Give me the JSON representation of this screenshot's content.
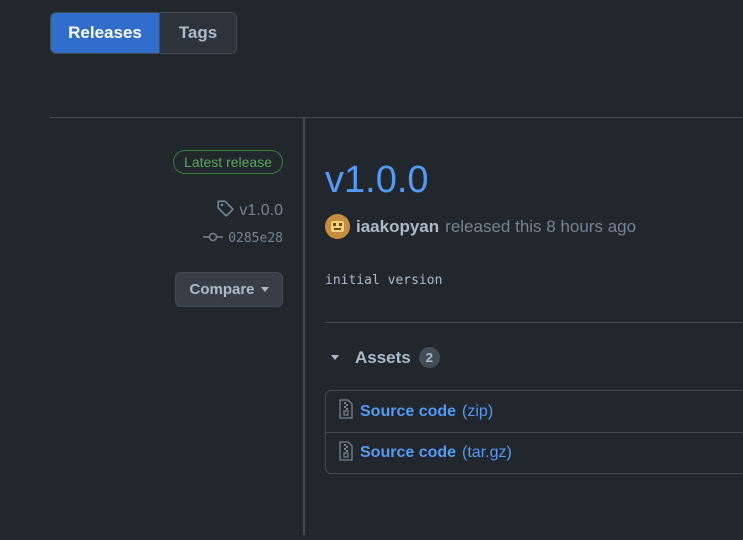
{
  "tabs": {
    "releases_label": "Releases",
    "tags_label": "Tags"
  },
  "sidebar": {
    "latest_badge": "Latest release",
    "tag": "v1.0.0",
    "commit": "0285e28",
    "compare_label": "Compare"
  },
  "release": {
    "title": "v1.0.0",
    "author": "iaakopyan",
    "released_text": "released this 8 hours ago",
    "body": "initial version"
  },
  "assets": {
    "label": "Assets",
    "count": "2",
    "items": [
      {
        "name": "Source code",
        "ext": "(zip)"
      },
      {
        "name": "Source code",
        "ext": "(tar.gz)"
      }
    ]
  },
  "colors": {
    "background": "#22272e",
    "accent": "#316dca",
    "link": "#539bf5",
    "success": "#57ab5a",
    "border": "#444c56"
  }
}
